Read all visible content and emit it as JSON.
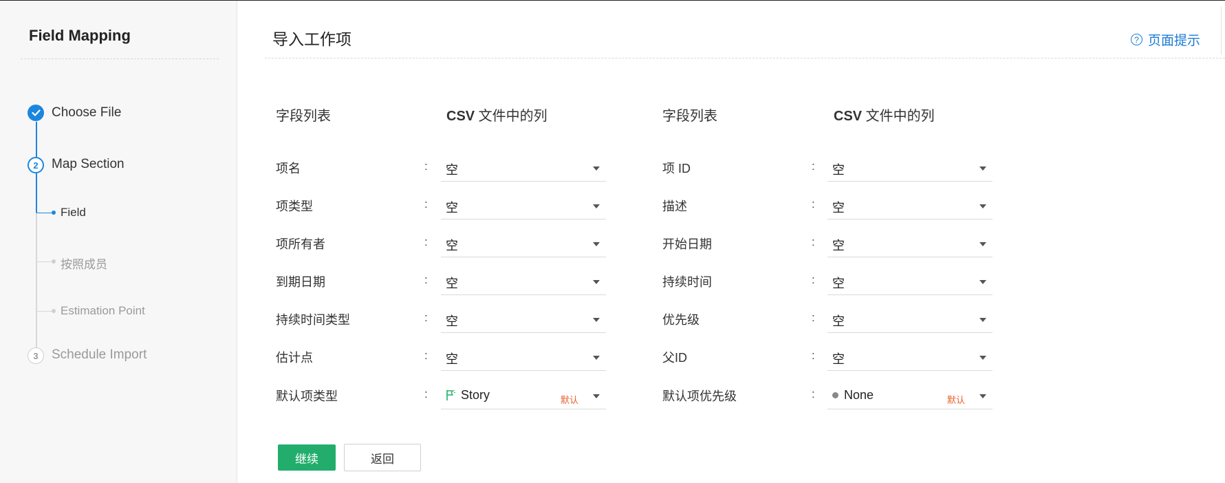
{
  "sidebar": {
    "title": "Field Mapping",
    "steps": [
      {
        "number": "",
        "label": "Choose File",
        "state": "done"
      },
      {
        "number": "2",
        "label": "Map Section",
        "state": "active"
      },
      {
        "number": "3",
        "label": "Schedule Import",
        "state": "pending"
      }
    ],
    "substeps": [
      {
        "label": "Field",
        "state": "active"
      },
      {
        "label": "按照成员",
        "state": "pending"
      },
      {
        "label": "Estimation Point",
        "state": "pending"
      }
    ]
  },
  "header": {
    "title": "导入工作项",
    "help_label": "页面提示",
    "help_icon": "question-circle-icon"
  },
  "columns": {
    "field_list": "字段列表",
    "csv_prefix": "CSV",
    "csv_suffix": " 文件中的列"
  },
  "left_rows": [
    {
      "label": "项名",
      "value": "空"
    },
    {
      "label": "项类型",
      "value": "空"
    },
    {
      "label": "项所有者",
      "value": "空"
    },
    {
      "label": "到期日期",
      "value": "空"
    },
    {
      "label": "持续时间类型",
      "value": "空"
    },
    {
      "label": "估计点",
      "value": "空"
    },
    {
      "label": "默认项类型",
      "value": "Story",
      "badge": "默认",
      "icon": "flag-icon"
    }
  ],
  "right_rows": [
    {
      "label": "项 ID",
      "value": "空"
    },
    {
      "label": "描述",
      "value": "空"
    },
    {
      "label": "开始日期",
      "value": "空"
    },
    {
      "label": "持续时间",
      "value": "空"
    },
    {
      "label": "优先级",
      "value": "空"
    },
    {
      "label": "父ID",
      "value": "空"
    },
    {
      "label": "默认项优先级",
      "value": "None",
      "badge": "默认",
      "icon": "dot-icon"
    }
  ],
  "colon": ":",
  "buttons": {
    "continue": "继续",
    "back": "返回"
  },
  "colors": {
    "accent_blue": "#1a86e0",
    "primary_green": "#22ad6c",
    "default_badge": "#e8602c"
  }
}
